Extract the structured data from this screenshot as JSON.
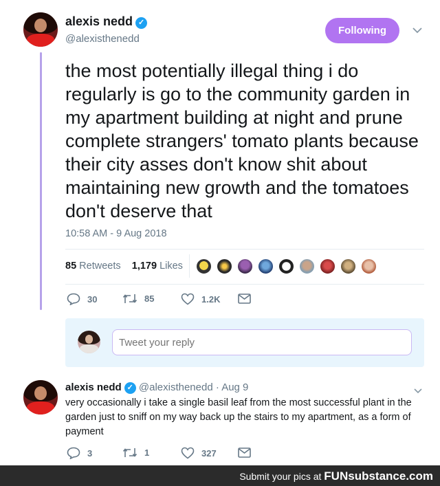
{
  "tweet": {
    "author_name": "alexis nedd",
    "author_handle": "@alexisthenedd",
    "verified_mark": "✓",
    "follow_label": "Following",
    "text": "the most potentially illegal thing i do regularly is go to the community garden in my apartment building at night and prune complete strangers' tomato plants because their city asses don't know shit about maintaining new growth and the tomatoes don't deserve that",
    "timestamp": "10:58 AM - 9 Aug 2018",
    "retweets_count": "85",
    "retweets_label": "Retweets",
    "likes_count": "1,179",
    "likes_label": "Likes",
    "actions": {
      "replies": "30",
      "retweets": "85",
      "likes": "1.2K"
    }
  },
  "reply_composer": {
    "placeholder": "Tweet your reply"
  },
  "reply_tweet": {
    "author_name": "alexis nedd",
    "author_handle": "@alexisthenedd",
    "date": "· Aug 9",
    "text": "very occasionally i take a single basil leaf from the most successful plant in the garden just to sniff on my way back up the stairs to my apartment, as a form of payment",
    "actions": {
      "replies": "3",
      "retweets": "1",
      "likes": "327"
    }
  },
  "footer": {
    "prefix": "Submit your pics at",
    "brand": "FUNsubstance.com"
  },
  "colors": {
    "accent": "#b174f1",
    "thread_line": "#b6a2ea",
    "icon": "#657786",
    "verified": "#1da1f2"
  },
  "icons": [
    "chevron-down-icon",
    "reply-icon",
    "retweet-icon",
    "heart-icon",
    "message-icon",
    "verified-badge-icon"
  ]
}
